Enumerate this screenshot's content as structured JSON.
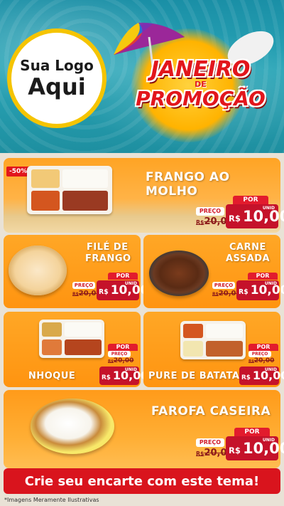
{
  "header": {
    "logo_line1": "Sua Logo",
    "logo_line2": "Aqui",
    "promo_line1": "JANEIRO",
    "promo_line2": "DE",
    "promo_line3": "PROMOÇÃO"
  },
  "products": {
    "frango_molho": {
      "name": "FRANGO AO MOLHO",
      "discount": "-50%",
      "preco_label": "PREÇO",
      "por_label": "POR",
      "old_currency": "R$",
      "old_price": "20,00",
      "currency": "R$",
      "new_price": "10,00",
      "unit": "UNID"
    },
    "file_frango": {
      "name_line1": "FILÉ DE",
      "name_line2": "FRANGO",
      "preco_label": "PREÇO",
      "por_label": "POR",
      "old_currency": "R$",
      "old_price": "20,00",
      "currency": "R$",
      "new_price": "10,00",
      "unit": "UNID"
    },
    "carne_assada": {
      "name_line1": "CARNE",
      "name_line2": "ASSADA",
      "preco_label": "PREÇO",
      "por_label": "POR",
      "old_currency": "R$",
      "old_price": "20,00",
      "currency": "R$",
      "new_price": "10,00",
      "unit": "UNID"
    },
    "nhoque": {
      "name": "NHOQUE",
      "preco_label": "PREÇO",
      "por_label": "POR",
      "old_currency": "R$",
      "old_price": "20,00",
      "currency": "R$",
      "new_price": "10,00",
      "unit": "UNID"
    },
    "pure_batata": {
      "name": "PURE DE BATATA",
      "preco_label": "PREÇO",
      "por_label": "POR",
      "old_currency": "R$",
      "old_price": "20,00",
      "currency": "R$",
      "new_price": "10,00",
      "unit": "UNID"
    },
    "farofa": {
      "name": "FAROFA CASEIRA",
      "preco_label": "PREÇO",
      "por_label": "POR",
      "old_currency": "R$",
      "old_price": "20,00",
      "currency": "R$",
      "new_price": "10,00",
      "unit": "UNID"
    }
  },
  "cta": {
    "label": "Crie seu encarte com este tema!"
  },
  "footer": {
    "note": "*Imagens Meramente Ilustrativas"
  },
  "colors": {
    "accent_red": "#e2161c",
    "price_red": "#c5122a",
    "panel_orange": "#ffa726",
    "logo_ring": "#f5c400"
  }
}
